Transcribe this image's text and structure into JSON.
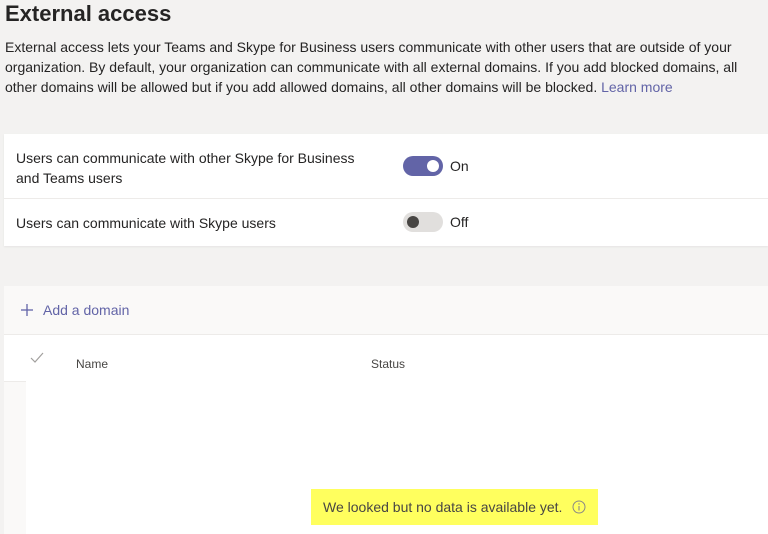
{
  "page": {
    "title": "External access",
    "description": "External access lets your Teams and Skype for Business users communicate with other users that are outside of your organization. By default, your organization can communicate with all external domains. If you add blocked domains, all other domains will be allowed but if you add allowed domains, all other domains will be blocked.",
    "learn_more": "Learn more"
  },
  "settings": [
    {
      "label": "Users can communicate with other Skype for Business and Teams users",
      "state": "On",
      "enabled": true
    },
    {
      "label": "Users can communicate with Skype users",
      "state": "Off",
      "enabled": false
    }
  ],
  "domains": {
    "add_label": "Add a domain",
    "columns": {
      "name": "Name",
      "status": "Status"
    },
    "empty_message": "We looked but no data is available yet."
  },
  "colors": {
    "accent": "#6264a7",
    "toggle_off": "#e1dfdd",
    "highlight": "#ffff5e"
  },
  "icons": {
    "add": "plus-icon",
    "select_all": "check-icon",
    "info": "info-icon"
  }
}
